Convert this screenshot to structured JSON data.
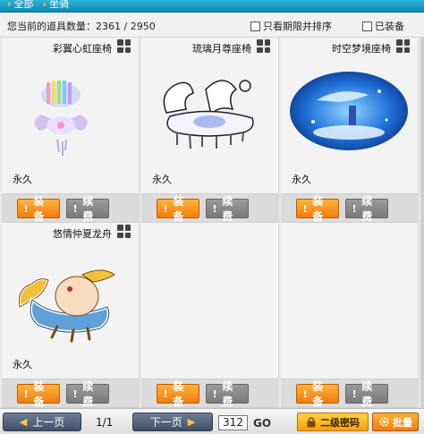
{
  "breadcrumb": {
    "item1": "全部",
    "item2": "坐骑"
  },
  "info": {
    "count_label": "您当前的道具数量：2361 / 2950",
    "filter_label": "只看期限并排序",
    "equipped_label": "已装备"
  },
  "items": [
    {
      "name": "彩翼心虹座椅",
      "duration": "永久",
      "equip": "装备",
      "renew": "续费"
    },
    {
      "name": "琉璃月尊座椅",
      "duration": "永久",
      "equip": "装备",
      "renew": "续费"
    },
    {
      "name": "时空梦境座椅",
      "duration": "永久",
      "equip": "装备",
      "renew": "续费"
    },
    {
      "name": "悠情仲夏龙舟",
      "duration": "永久",
      "equip": "装备",
      "renew": "续费"
    },
    {
      "name": "",
      "duration": "",
      "equip": "装备",
      "renew": "续费"
    },
    {
      "name": "",
      "duration": "",
      "equip": "装备",
      "renew": "续费"
    }
  ],
  "pagination": {
    "prev": "上一页",
    "page_info": "1/1",
    "next": "下一页",
    "page_input": "312",
    "go": "GO"
  },
  "actions": {
    "password": "二级密码",
    "batch": "批量"
  }
}
